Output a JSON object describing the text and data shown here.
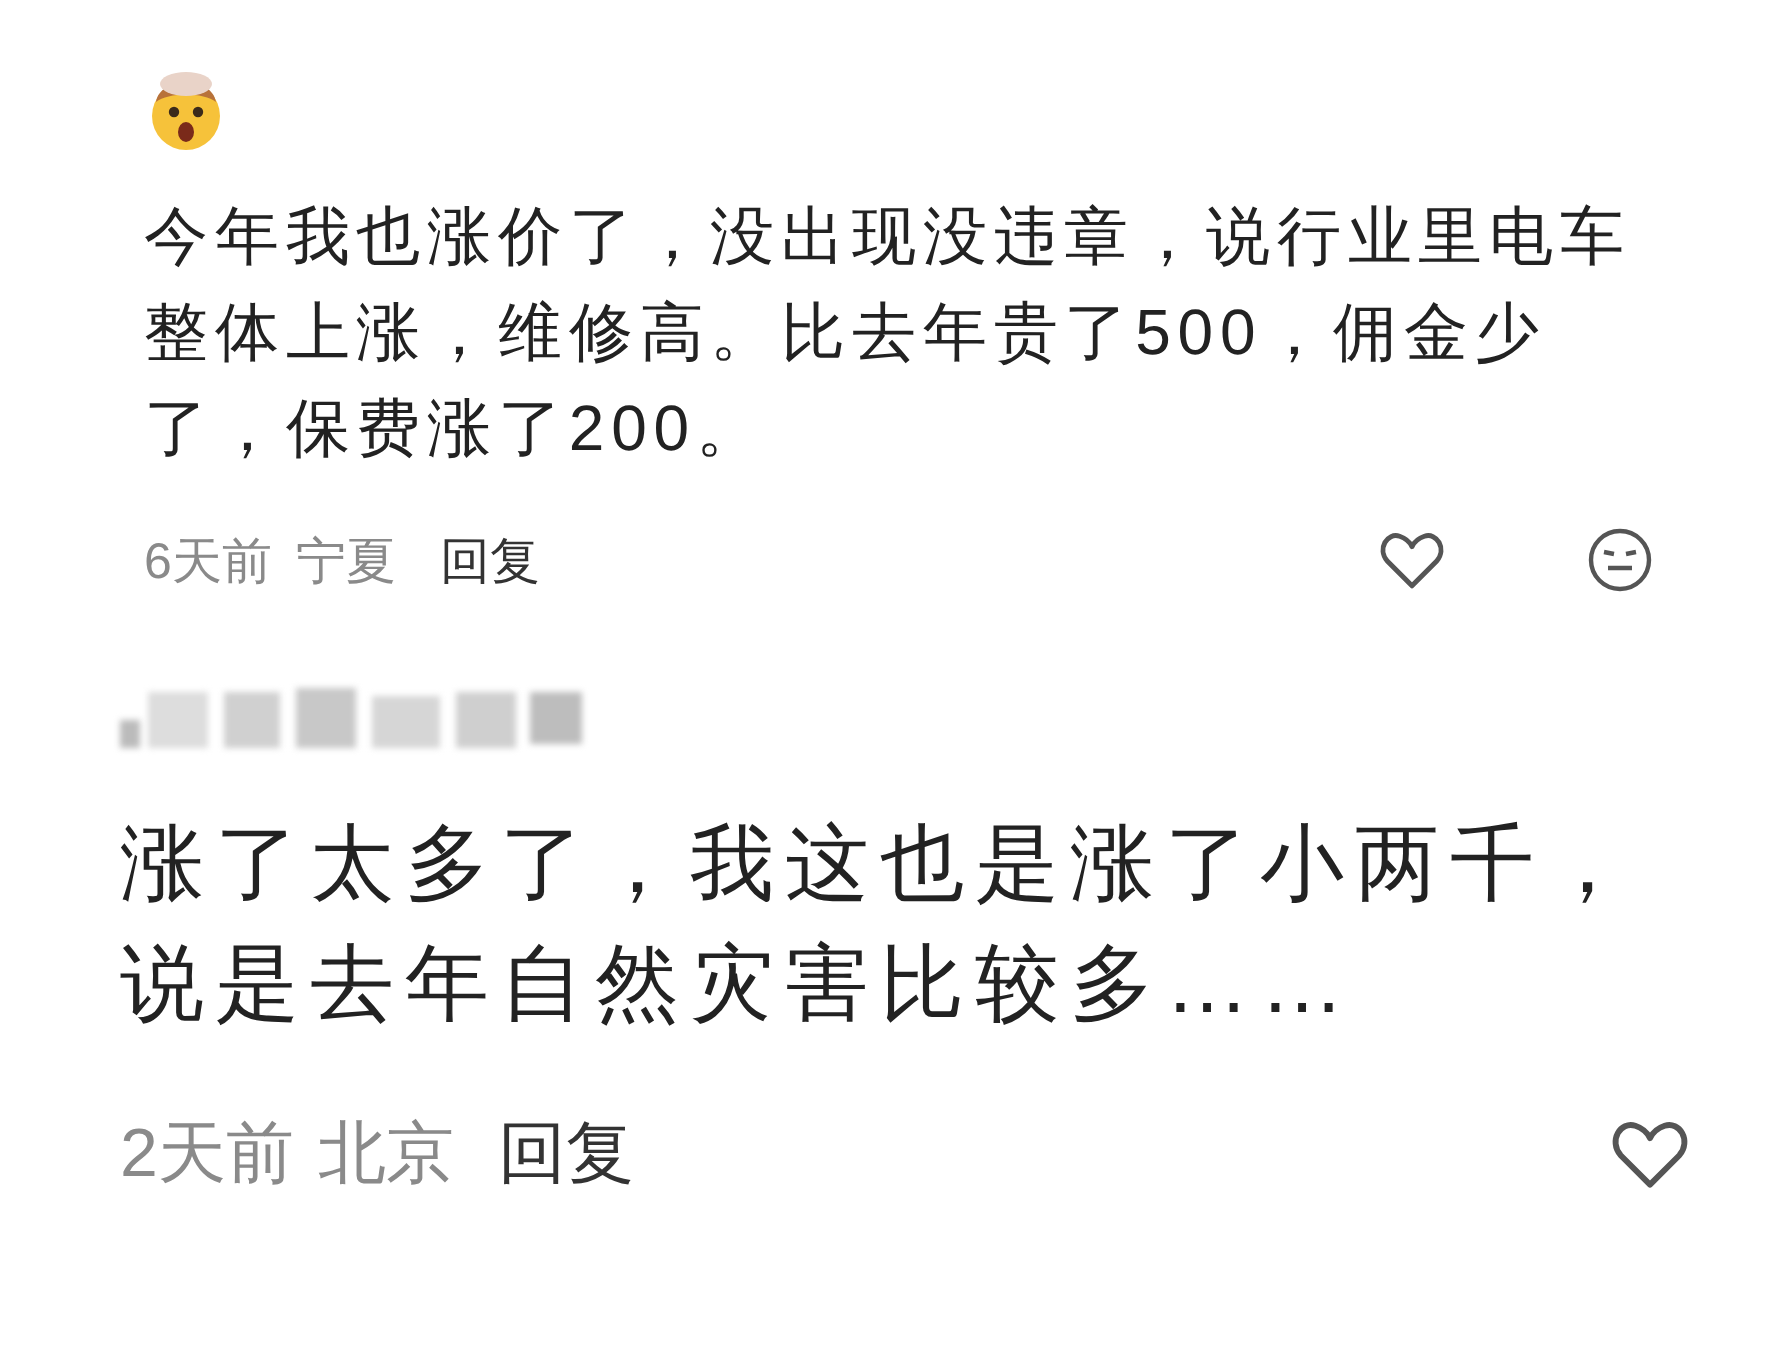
{
  "comments": [
    {
      "kind": "emoji",
      "text": "今年我也涨价了，没出现没违章，说行业里电车整体上涨，维修高。比去年贵了500，佣金少了，保费涨了200。",
      "time": "6天前",
      "location": "宁夏",
      "reply": "回复"
    },
    {
      "kind": "blurred",
      "text": "涨了太多了，我这也是涨了小两千，说是去年自然灾害比较多……",
      "time": "2天前",
      "location": "北京",
      "reply": "回复"
    }
  ]
}
